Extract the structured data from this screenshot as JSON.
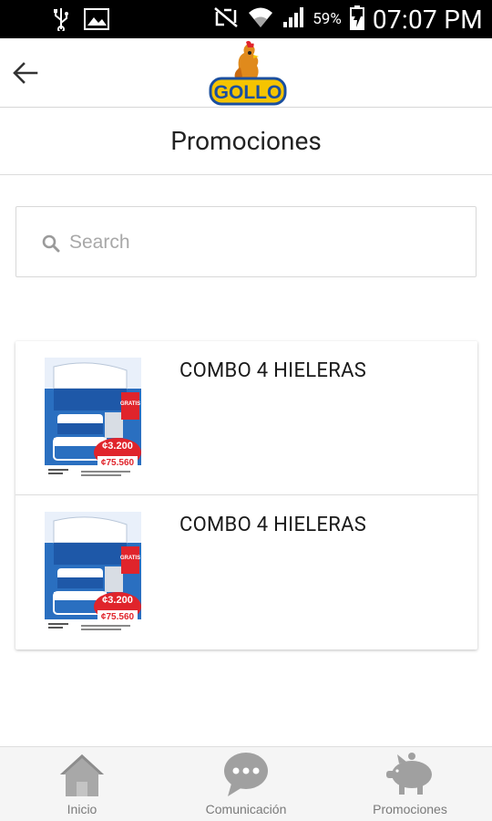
{
  "status_bar": {
    "battery_percent": "59%",
    "time": "07:07 PM"
  },
  "app_bar": {
    "logo_text": "GOLLO"
  },
  "page": {
    "title": "Promociones"
  },
  "search": {
    "placeholder": "Search",
    "value": ""
  },
  "promotions": [
    {
      "title": "COMBO 4 HIELERAS",
      "image_price_tag": "¢3.200",
      "image_total": "¢75.560",
      "image_badge": "GRATIS"
    },
    {
      "title": "COMBO 4 HIELERAS",
      "image_price_tag": "¢3.200",
      "image_total": "¢75.560",
      "image_badge": "GRATIS"
    }
  ],
  "bottom_nav": {
    "items": [
      {
        "label": "Inicio",
        "icon": "home-icon"
      },
      {
        "label": "Comunicación",
        "icon": "chat-bubble-icon"
      },
      {
        "label": "Promociones",
        "icon": "piggy-bank-icon"
      }
    ]
  },
  "colors": {
    "status_bar": "#000000",
    "logo_blue": "#1a4fa0",
    "logo_yellow": "#f5c400",
    "nav_icon": "#9e9e9e",
    "promo_red": "#e0242b"
  }
}
